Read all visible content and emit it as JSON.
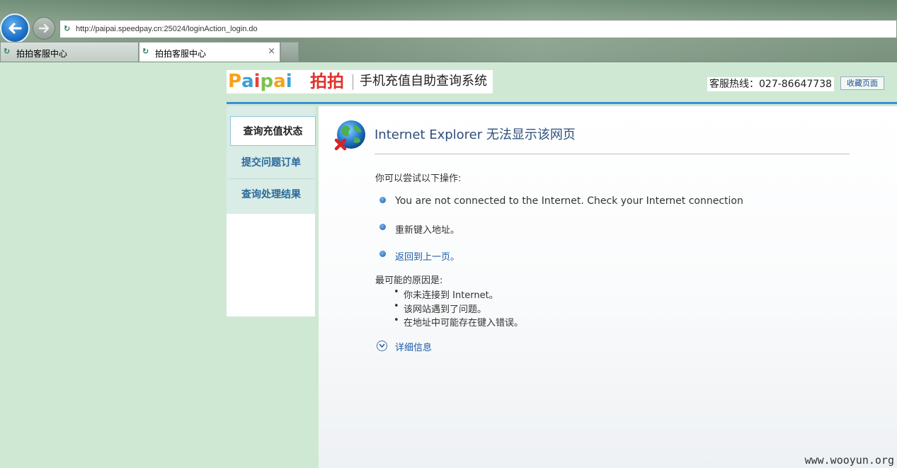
{
  "browser": {
    "address": "http://paipai.speedpay.cn:25024/loginAction_login.do",
    "site_icon_glyph": "↻",
    "tabs": [
      {
        "label": "拍拍客服中心",
        "active": false
      },
      {
        "label": "拍拍客服中心",
        "active": true
      }
    ],
    "close_glyph": "×"
  },
  "header": {
    "logo_letters": [
      "P",
      "a",
      "i",
      "p",
      "a",
      "i"
    ],
    "logo_colors": [
      "#f7a21b",
      "#3ba0d8",
      "#e6423a",
      "#7cc24c",
      "#f7a21b",
      "#3ba0d8"
    ],
    "logo_cn": "拍拍",
    "system_title": "手机充值自助查询系统",
    "hotline": "客服热线：027-86647738",
    "favorite_button": "收藏页面"
  },
  "menu": {
    "items": [
      {
        "label": "查询充值状态",
        "selected": true
      },
      {
        "label": "提交问题订单",
        "selected": false
      },
      {
        "label": "查询处理结果",
        "selected": false
      }
    ]
  },
  "error_page": {
    "title": "Internet Explorer 无法显示该网页",
    "try_heading": "你可以尝试以下操作:",
    "actions": [
      "You are not connected to the Internet.  Check your Internet connection",
      "重新键入地址。",
      "返回到上一页。"
    ],
    "causes_heading": "最可能的原因是:",
    "causes": [
      "你未连接到 Internet。",
      "该网站遇到了问题。",
      "在地址中可能存在键入错误。"
    ],
    "details_link": "详细信息"
  },
  "watermark": "www.wooyun.org"
}
